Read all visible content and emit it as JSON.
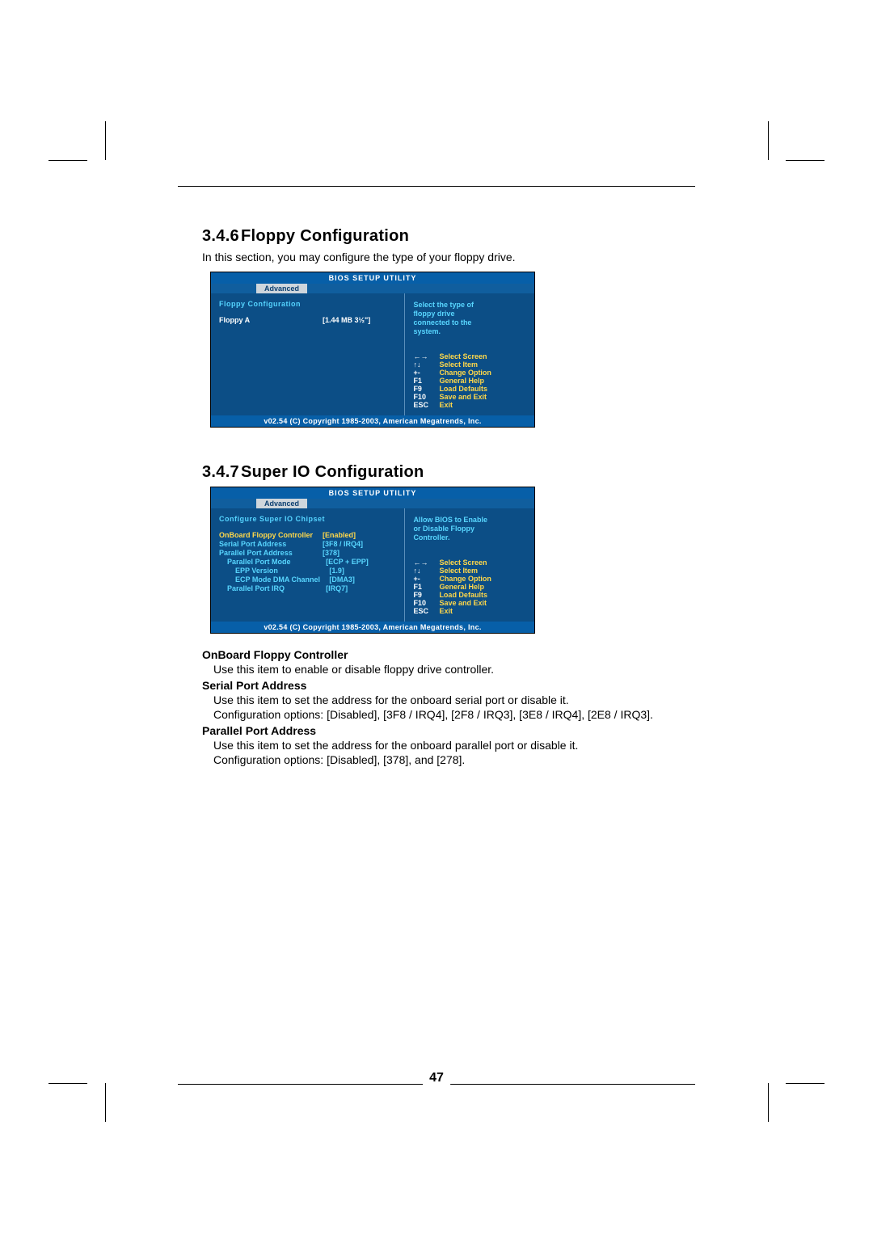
{
  "page_number": "47",
  "sections": {
    "floppy": {
      "heading_num": "3.4.6",
      "heading_txt": "Floppy Configuration",
      "intro": "In this section, you may configure the type of your floppy drive."
    },
    "superio": {
      "heading_num": "3.4.7",
      "heading_txt": "Super IO Configuration",
      "items": {
        "onboard_h": "OnBoard Floppy Controller",
        "onboard_p": "Use this item to enable or disable floppy drive controller.",
        "serial_h": "Serial Port Address",
        "serial_p1": "Use this item to set the address for the onboard serial port or disable it.",
        "serial_p2": "Configuration options: [Disabled], [3F8 / IRQ4], [2F8 / IRQ3], [3E8 / IRQ4], [2E8 / IRQ3].",
        "parallel_h": "Parallel Port Address",
        "parallel_p1": "Use this item to set the address for the onboard parallel port or disable it.",
        "parallel_p2": "Configuration options: [Disabled], [378], and [278]."
      }
    }
  },
  "bios_common": {
    "title": "BIOS SETUP UTILITY",
    "tab": "Advanced",
    "footer": "v02.54 (C) Copyright 1985-2003, American Megatrends, Inc.",
    "keys": [
      {
        "k": "←→",
        "d": "Select Screen"
      },
      {
        "k": "↑↓",
        "d": "Select Item"
      },
      {
        "k": "+-",
        "d": "Change Option"
      },
      {
        "k": "F1",
        "d": "General Help"
      },
      {
        "k": "F9",
        "d": "Load Defaults"
      },
      {
        "k": "F10",
        "d": "Save and Exit"
      },
      {
        "k": "ESC",
        "d": "Exit"
      }
    ]
  },
  "bios1": {
    "left_header": "Floppy Configuration",
    "row": {
      "k": "Floppy A",
      "v": "[1.44 MB 3½\"]"
    },
    "help": [
      "Select the type of",
      "floppy drive",
      "connected to the",
      "system."
    ]
  },
  "bios2": {
    "left_header": "Configure Super IO Chipset",
    "rows": [
      {
        "k": "OnBoard Floppy Controller",
        "v": "[Enabled]",
        "cls": "opt-row"
      },
      {
        "k": "Serial Port Address",
        "v": "[3F8 / IRQ4]",
        "cls": "opt-row cyan"
      },
      {
        "k": "Parallel Port Address",
        "v": "[378]",
        "cls": "opt-row cyan"
      },
      {
        "k": "Parallel Port Mode",
        "v": "[ECP + EPP]",
        "cls": "opt-row cyan indent1"
      },
      {
        "k": "EPP Version",
        "v": "[1.9]",
        "cls": "opt-row cyan indent2"
      },
      {
        "k": "ECP Mode DMA Channel",
        "v": "[DMA3]",
        "cls": "opt-row cyan indent2"
      },
      {
        "k": "Parallel Port IRQ",
        "v": "[IRQ7]",
        "cls": "opt-row cyan indent1"
      }
    ],
    "help": [
      "Allow BIOS to Enable",
      "or Disable Floppy",
      "Controller."
    ]
  }
}
